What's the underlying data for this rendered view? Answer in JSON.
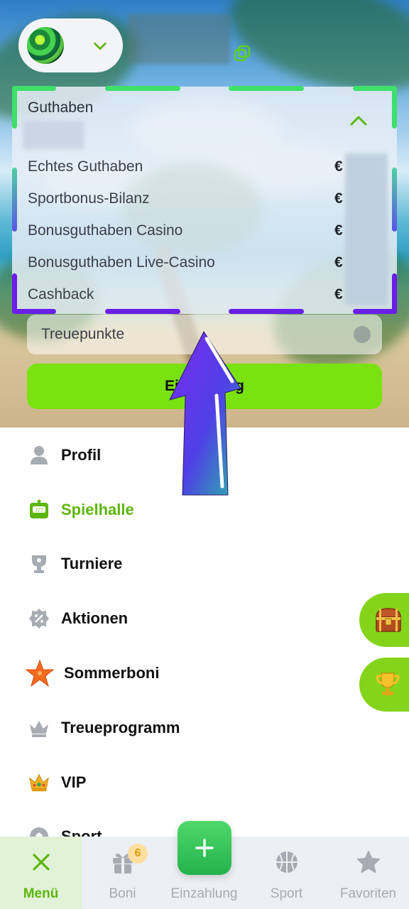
{
  "colors": {
    "accent_green": "#7be212",
    "active_green": "#5cb50c",
    "frame_green": "#3ee06a",
    "frame_purple": "#6a1ee8",
    "nav_inactive": "#a7abb3"
  },
  "header": {
    "avatar_icon": "planet-avatar",
    "dropdown_icon": "chevron-down-icon",
    "copy_icon": "copy-icon"
  },
  "balance": {
    "title": "Guthaben",
    "rows": [
      {
        "label": "Echtes Guthaben",
        "currency": "€"
      },
      {
        "label": "Sportbonus-Bilanz",
        "currency": "€"
      },
      {
        "label": "Bonusguthaben Casino",
        "currency": "€"
      },
      {
        "label": "Bonusguthaben Live-Casino",
        "currency": "€"
      },
      {
        "label": "Cashback",
        "currency": "€"
      }
    ],
    "loyalty_label": "Treuepunkte",
    "deposit_button": "Einzahlung"
  },
  "menu": {
    "items": [
      {
        "label": "Profil",
        "icon": "user-icon"
      },
      {
        "label": "Spielhalle",
        "icon": "slot-machine-icon",
        "active": true
      },
      {
        "label": "Turniere",
        "icon": "trophy-icon"
      },
      {
        "label": "Aktionen",
        "icon": "percent-badge-icon"
      },
      {
        "label": "Sommerboni",
        "icon": "starfish-icon"
      },
      {
        "label": "Treueprogramm",
        "icon": "crown-icon"
      },
      {
        "label": "VIP",
        "icon": "gold-crown-icon"
      },
      {
        "label": "Sport",
        "icon": "soccer-ball-icon"
      }
    ]
  },
  "floating": {
    "chest_icon": "treasure-chest-icon",
    "trophy_icon": "gold-trophy-icon"
  },
  "bottom_nav": {
    "tabs": [
      {
        "label": "Menü",
        "icon": "close-icon",
        "active": true
      },
      {
        "label": "Boni",
        "icon": "gift-icon",
        "badge": "6"
      },
      {
        "label": "Einzahlung",
        "icon": "plus-icon"
      },
      {
        "label": "Sport",
        "icon": "basketball-icon"
      },
      {
        "label": "Favoriten",
        "icon": "star-icon"
      }
    ]
  }
}
